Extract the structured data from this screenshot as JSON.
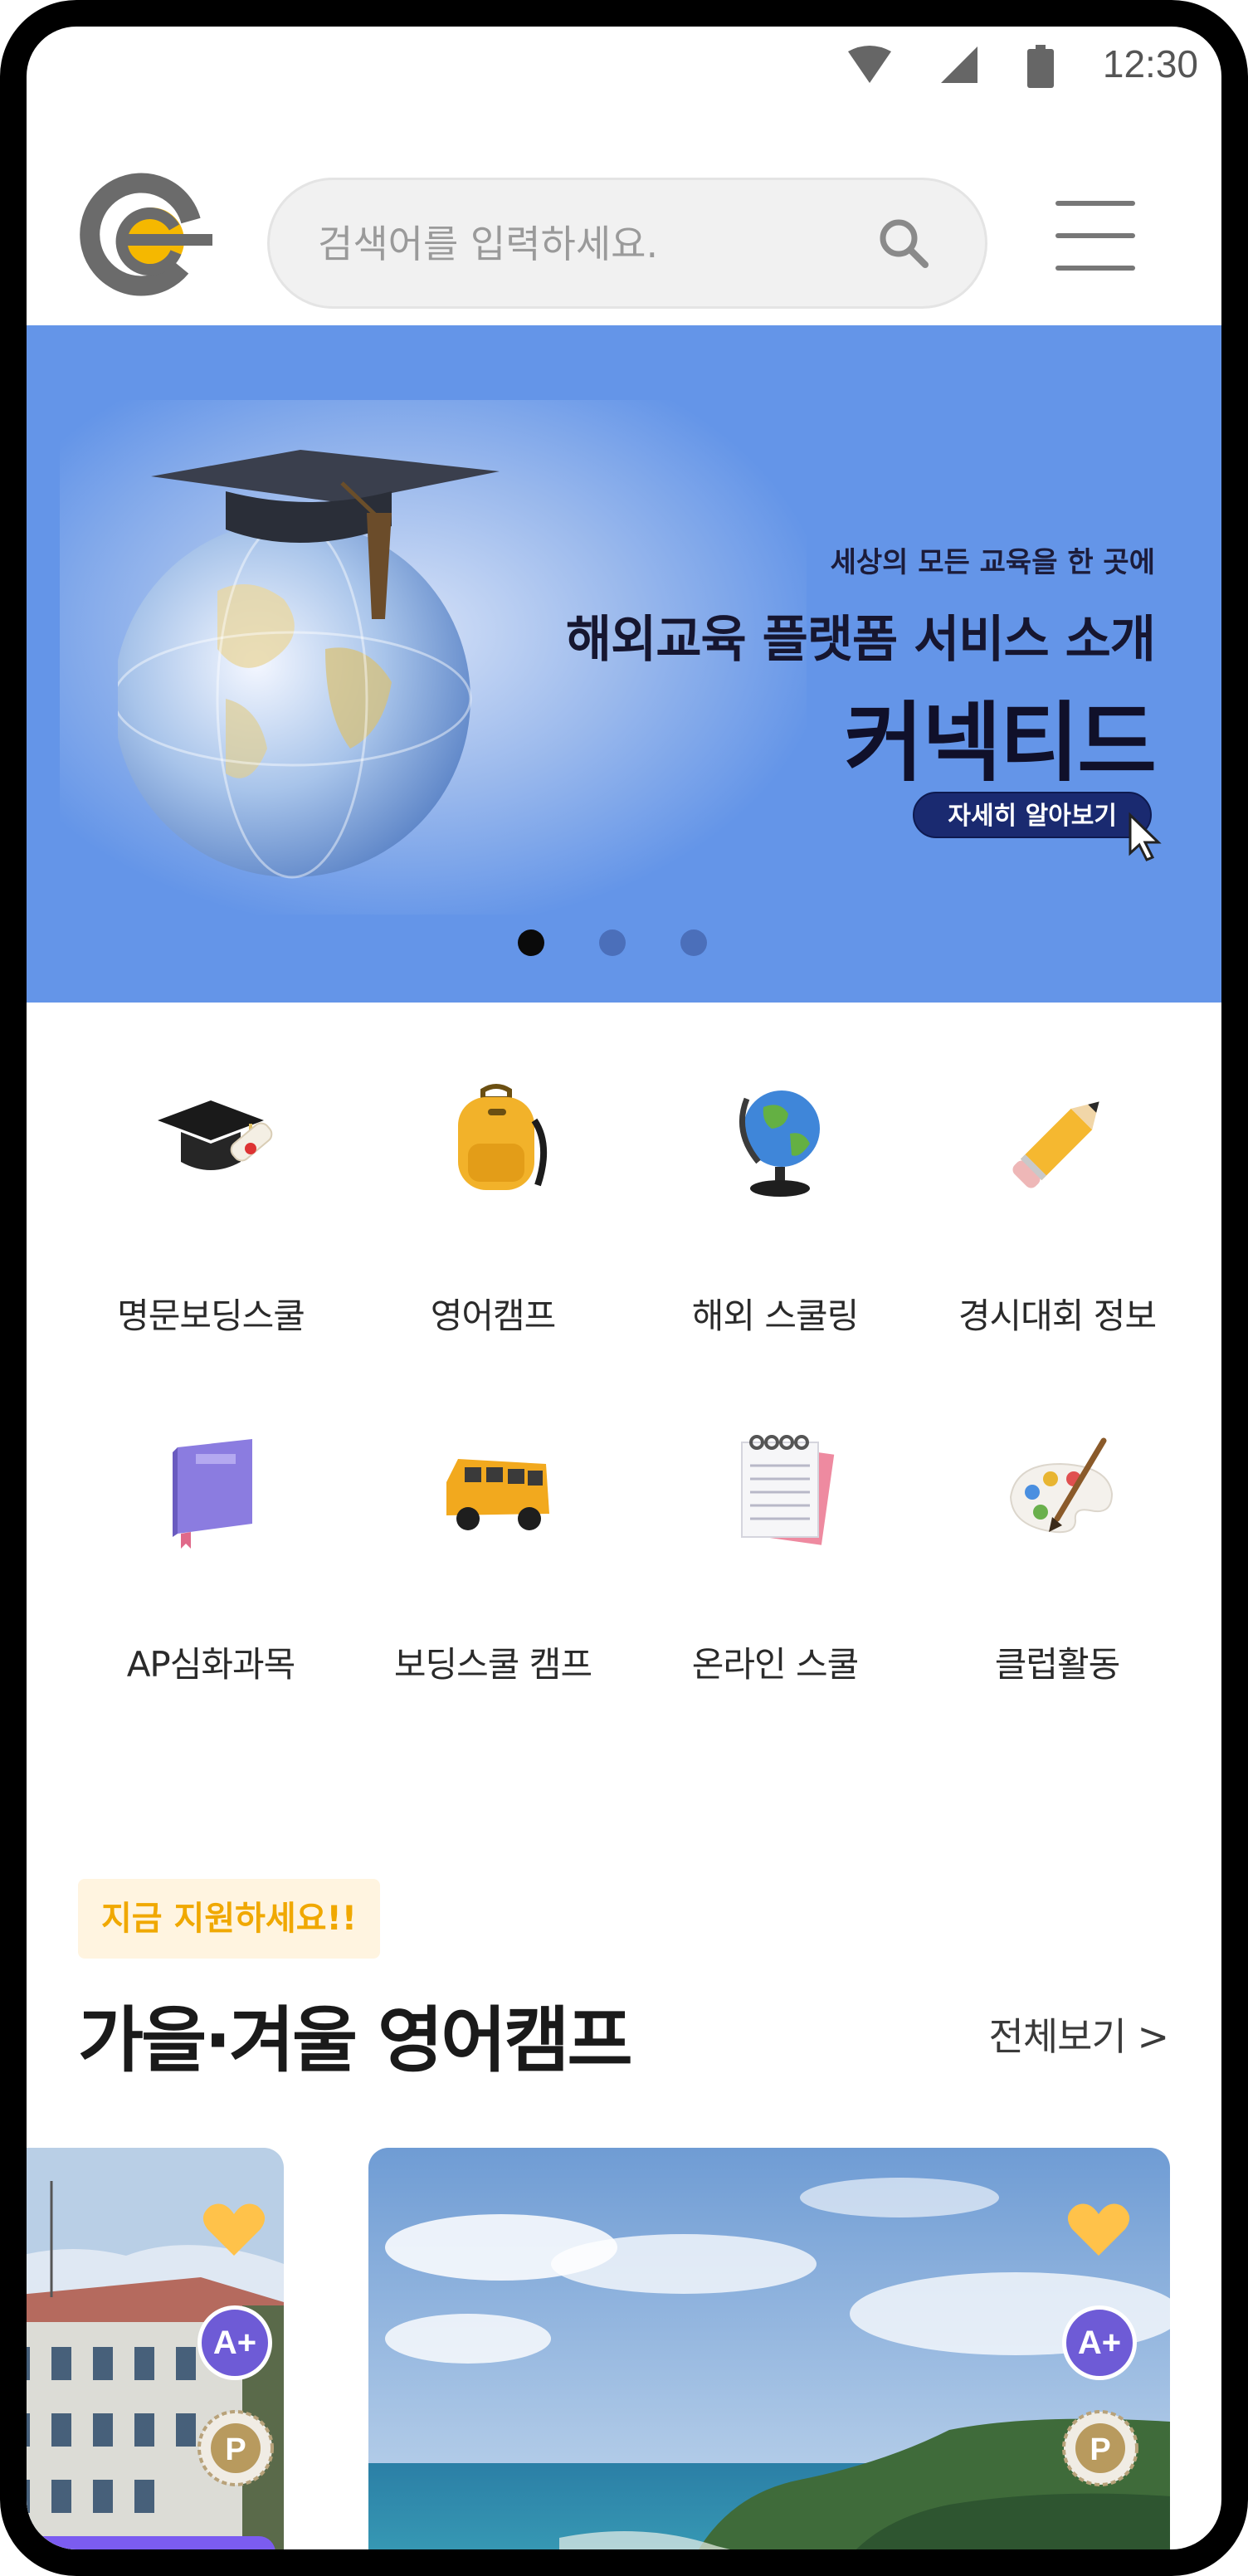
{
  "status_bar": {
    "time": "12:30",
    "icons": [
      "wifi-icon",
      "cellular-signal-icon",
      "battery-icon"
    ]
  },
  "header": {
    "logo": "connected-logo",
    "search": {
      "placeholder": "검색어를 입력하세요.",
      "value": ""
    },
    "icons": [
      "search-icon",
      "hamburger-menu-icon"
    ]
  },
  "banner": {
    "subtitle": "세상의 모든 교육을 한 곳에",
    "title": "해외교육 플랫폼 서비스 소개",
    "brand": "커넥티드",
    "button_label": "자세히 알아보기",
    "slide_count": 3,
    "active_slide": 1,
    "background_color": "#6495e8"
  },
  "categories": [
    {
      "label": "명문보딩스쿨",
      "icon": "graduation-cap-diploma-icon"
    },
    {
      "label": "영어캠프",
      "icon": "backpack-icon"
    },
    {
      "label": "해외 스쿨링",
      "icon": "globe-icon"
    },
    {
      "label": "경시대회 정보",
      "icon": "pencil-icon"
    },
    {
      "label": "AP심화과목",
      "icon": "book-icon"
    },
    {
      "label": "보딩스쿨 캠프",
      "icon": "school-bus-icon"
    },
    {
      "label": "온라인 스쿨",
      "icon": "notepad-icon"
    },
    {
      "label": "클럽활동",
      "icon": "paint-palette-icon"
    }
  ],
  "camp_section": {
    "badge": "지금 지원하세요!!",
    "title": "가을·겨울 영어캠프",
    "view_all": "전체보기 >",
    "badge_color": "#f0a800",
    "cards": [
      {
        "image": "school-building-photo",
        "grade": "A+",
        "rank_badge": "P",
        "favorited": true
      },
      {
        "image": "coastline-photo",
        "grade": "A+",
        "rank_badge": "P",
        "favorited": true
      }
    ]
  }
}
